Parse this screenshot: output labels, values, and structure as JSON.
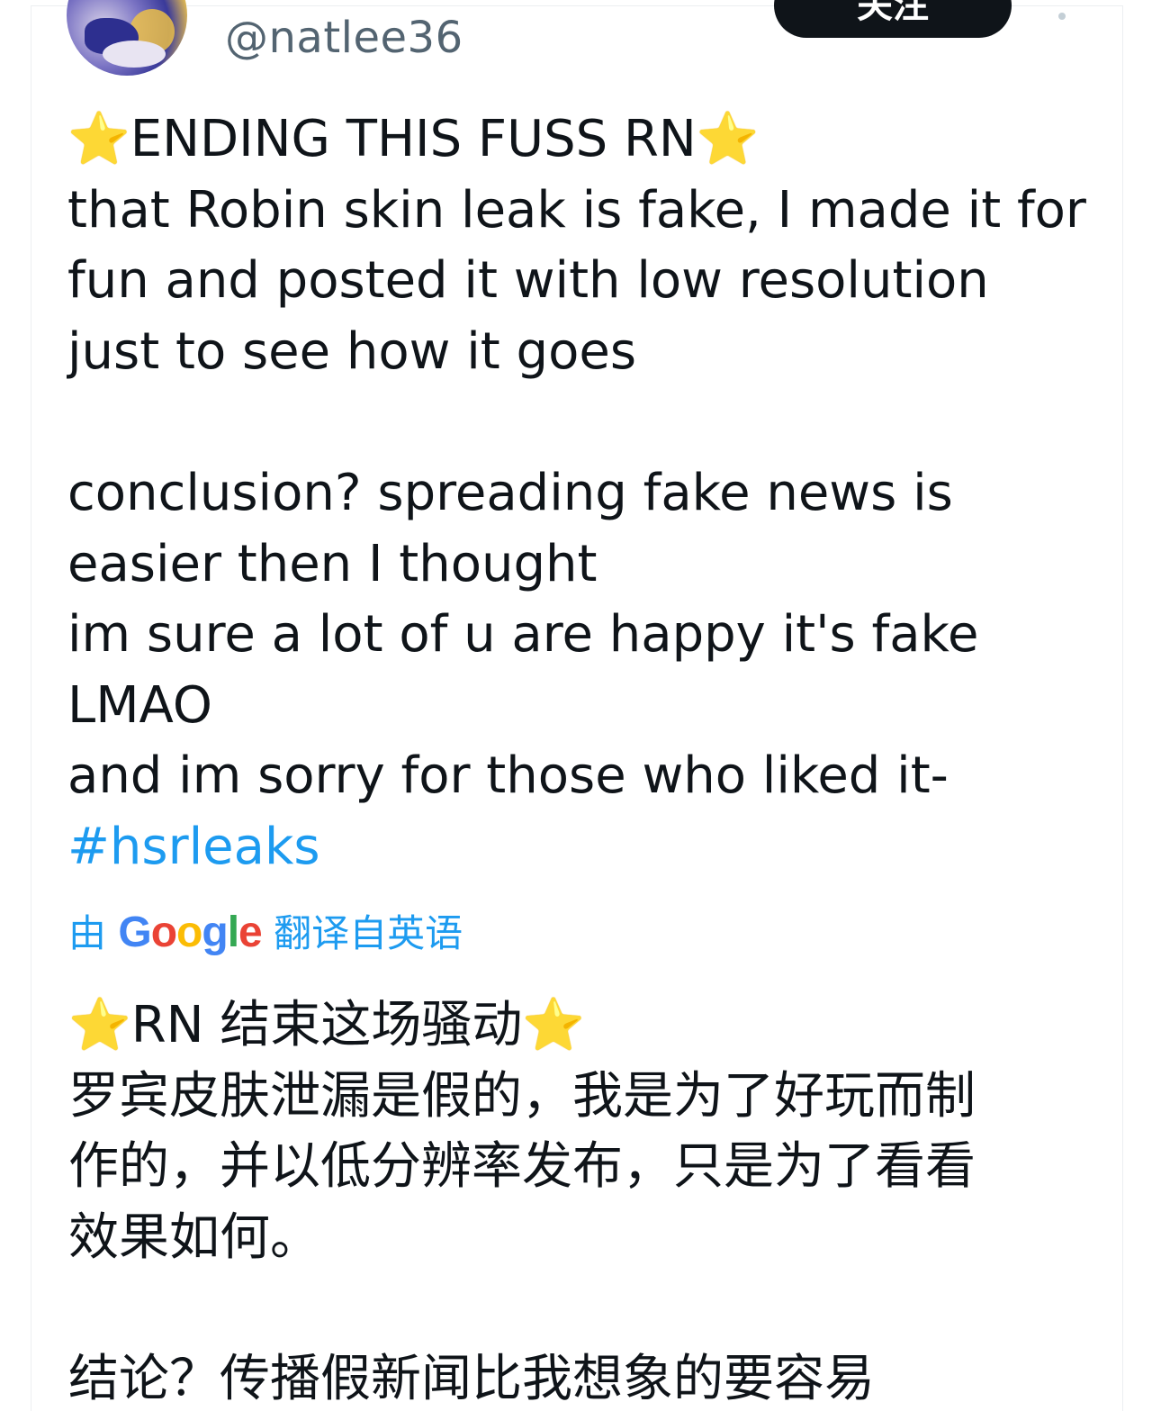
{
  "author": {
    "handle": "@natlee36",
    "follow_label": "关注"
  },
  "tweet": {
    "headline_star": "⭐",
    "headline_text": "ENDING THIS FUSS RN",
    "lines": [
      "that Robin skin leak is fake, I made it for",
      "fun and posted it with low resolution",
      "just to see how it goes",
      "conclusion? spreading fake news is",
      "easier then I thought",
      "im sure a lot of u are happy it's fake",
      "LMAO",
      "and im sorry for those who liked it-"
    ],
    "hashtag": "#hsrleaks"
  },
  "translation": {
    "prefix": "由",
    "google": [
      "G",
      "o",
      "o",
      "g",
      "l",
      "e"
    ],
    "suffix": "翻译自英语",
    "headline_text": "RN 结束这场骚动",
    "lines": [
      "罗宾皮肤泄漏是假的，我是为了好玩而制",
      "作的，并以低分辨率发布，只是为了看看",
      "效果如何。",
      "结论？传播假新闻比我想象的要容易"
    ]
  },
  "colors": {
    "link": "#1d9bf0",
    "text": "#0f1419",
    "handle": "#536471",
    "star": "#f7c531"
  }
}
